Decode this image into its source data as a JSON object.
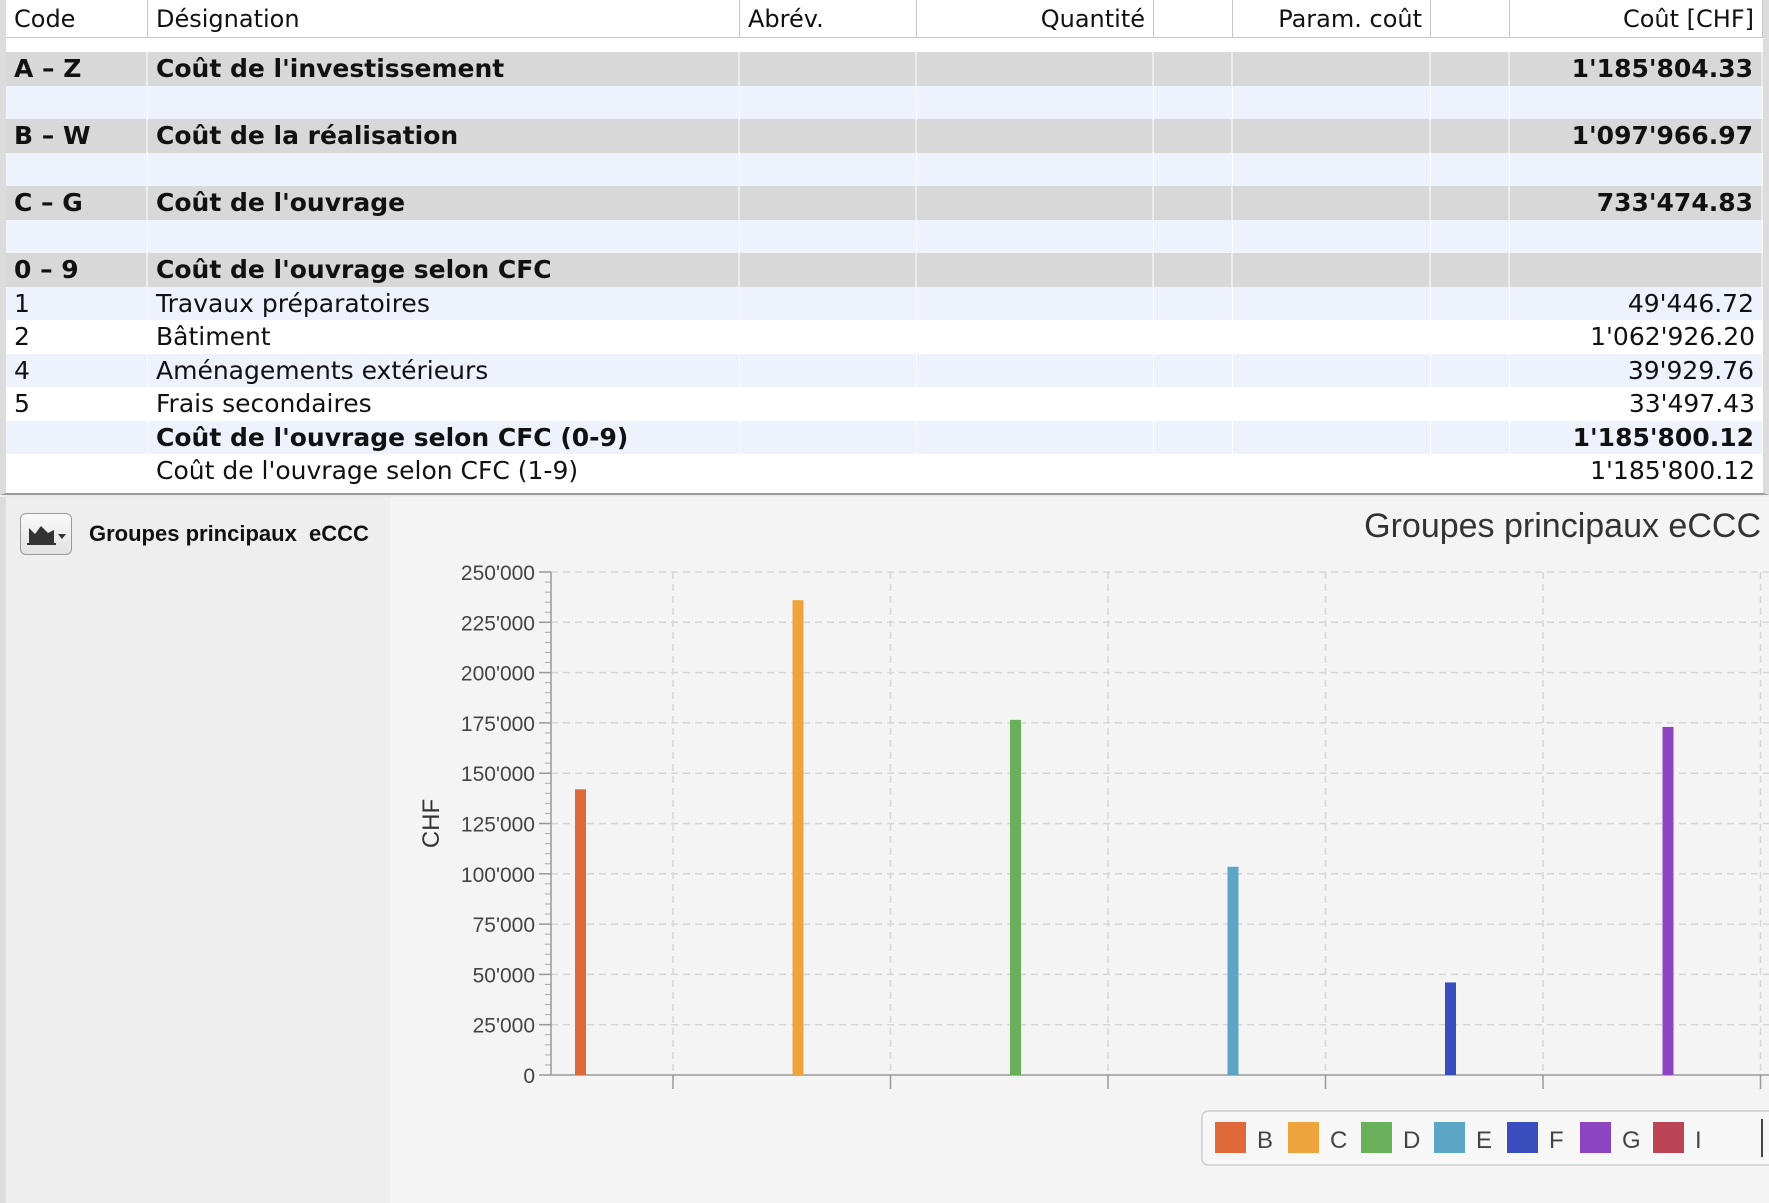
{
  "table": {
    "headers": {
      "code": "Code",
      "designation": "Désignation",
      "abrev": "Abrév.",
      "quantite": "Quantité",
      "param": "Param. coût",
      "cout": "Coût [CHF]"
    },
    "rows": [
      {
        "style": "grey",
        "bold": true,
        "code": "A – Z",
        "designation": "Coût de l'investissement",
        "cost": "1'185'804.33"
      },
      {
        "style": "blue",
        "bold": false,
        "code": "",
        "designation": "",
        "cost": ""
      },
      {
        "style": "grey",
        "bold": true,
        "code": "B – W",
        "designation": "Coût de la réalisation",
        "cost": "1'097'966.97"
      },
      {
        "style": "blue",
        "bold": false,
        "code": "",
        "designation": "",
        "cost": ""
      },
      {
        "style": "grey",
        "bold": true,
        "code": "C – G",
        "designation": "Coût de l'ouvrage",
        "cost": "733'474.83"
      },
      {
        "style": "blue",
        "bold": false,
        "code": "",
        "designation": "",
        "cost": ""
      },
      {
        "style": "grey",
        "bold": true,
        "code": "0 – 9",
        "designation": "Coût de l'ouvrage selon CFC",
        "cost": ""
      },
      {
        "style": "blue",
        "bold": false,
        "code": "1",
        "designation": "Travaux préparatoires",
        "cost": "49'446.72"
      },
      {
        "style": "white",
        "bold": false,
        "code": "2",
        "designation": "Bâtiment",
        "cost": "1'062'926.20"
      },
      {
        "style": "blue",
        "bold": false,
        "code": "4",
        "designation": "Aménagements extérieurs",
        "cost": "39'929.76"
      },
      {
        "style": "white",
        "bold": false,
        "code": "5",
        "designation": "Frais secondaires",
        "cost": "33'497.43"
      },
      {
        "style": "blue",
        "bold": true,
        "code": "",
        "designation": "Coût de l'ouvrage selon CFC (0-9)",
        "cost": "1'185'800.12"
      },
      {
        "style": "white",
        "bold": false,
        "code": "",
        "designation": "Coût de l'ouvrage selon CFC (1-9)",
        "cost": "1'185'800.12"
      }
    ]
  },
  "panel": {
    "title": "Groupes principaux  eCCC",
    "chart_button_icon": "area-chart-icon"
  },
  "chart_data": {
    "type": "bar",
    "title": "Groupes principaux eCCC",
    "ylabel": "CHF",
    "xlabel": "",
    "ylim": [
      0,
      250000
    ],
    "yticks": [
      "0",
      "25'000",
      "50'000",
      "75'000",
      "100'000",
      "125'000",
      "150'000",
      "175'000",
      "200'000",
      "225'000",
      "250'000"
    ],
    "series": [
      {
        "name": "B",
        "value": 142000,
        "color": "#e0693b"
      },
      {
        "name": "C",
        "value": 236000,
        "color": "#eda43c"
      },
      {
        "name": "D",
        "value": 176500,
        "color": "#69b05b"
      },
      {
        "name": "E",
        "value": 103500,
        "color": "#5ba5c6"
      },
      {
        "name": "F",
        "value": 46000,
        "color": "#3a4dbd"
      },
      {
        "name": "G",
        "value": 173000,
        "color": "#8c44c0"
      }
    ],
    "legend_extra": [
      {
        "name": "I",
        "color": "#bb4455"
      }
    ],
    "legend_position": "bottom-right",
    "grid": true
  }
}
